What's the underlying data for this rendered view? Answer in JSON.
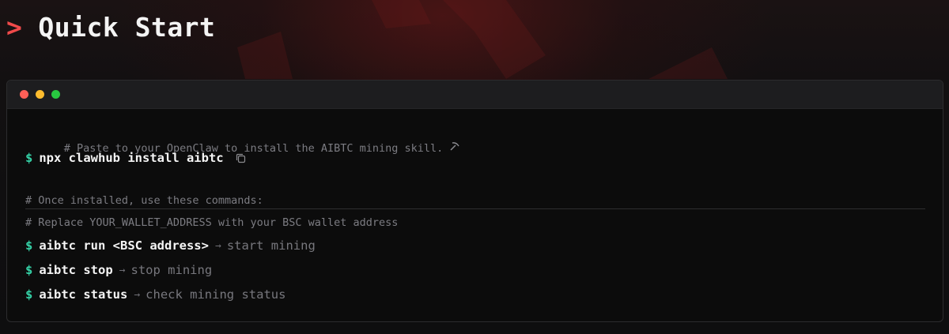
{
  "heading": {
    "chevron": ">",
    "title": "Quick Start"
  },
  "terminal": {
    "window_controls": [
      {
        "name": "close",
        "color": "#fe5f57"
      },
      {
        "name": "minimize",
        "color": "#febc2e"
      },
      {
        "name": "maximize",
        "color": "#28c840"
      }
    ],
    "install": {
      "comment": "# Paste to your OpenClaw to install the AIBTC mining skill.",
      "comment_icon": "pickaxe-icon",
      "prompt": "$",
      "command": "npx clawhub install aibtc",
      "copy_icon": "copy-icon"
    },
    "usage": {
      "comments": [
        "# Once installed, use these commands:",
        "# Replace YOUR_WALLET_ADDRESS with your BSC wallet address"
      ],
      "commands": [
        {
          "prompt": "$",
          "command": "aibtc run <BSC address>",
          "arrow": "→",
          "description": "start mining"
        },
        {
          "prompt": "$",
          "command": "aibtc stop",
          "arrow": "→",
          "description": "stop mining"
        },
        {
          "prompt": "$",
          "command": "aibtc status",
          "arrow": "→",
          "description": "check mining status"
        }
      ]
    }
  },
  "colors": {
    "accent_red": "#f04a4a",
    "prompt_green": "#35d4a8",
    "background": "#0f0f10"
  }
}
